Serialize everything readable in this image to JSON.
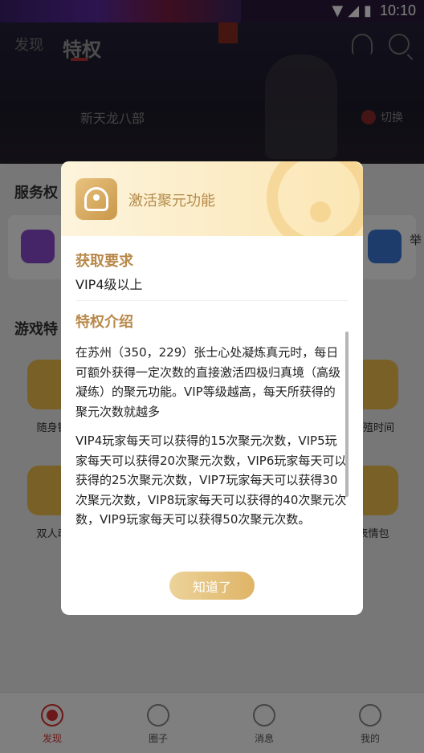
{
  "status_bar": {
    "time": "10:10"
  },
  "header": {
    "tabs": [
      {
        "label": "发现"
      },
      {
        "label": "特权"
      }
    ],
    "game_name": "新天龙八部",
    "switch_label": "切换"
  },
  "background": {
    "section_service": "服务权",
    "section_game": "游戏特",
    "svc_partial_label": "举",
    "grid_items": [
      {
        "label": "随身钳"
      },
      {
        "label": "紧殖时间"
      },
      {
        "label": "双人动"
      },
      {
        "label": "表情包"
      }
    ]
  },
  "bottom_nav": {
    "items": [
      {
        "label": "发现"
      },
      {
        "label": "圈子"
      },
      {
        "label": "消息"
      },
      {
        "label": "我的"
      }
    ]
  },
  "modal": {
    "title": "激活聚元功能",
    "requirement_heading": "获取要求",
    "requirement_value": "VIP4级以上",
    "intro_heading": "特权介绍",
    "intro_paragraphs": [
      "在苏州（350，229）张士心处凝炼真元时，每日可额外获得一定次数的直接激活四极归真境（高级凝练）的聚元功能。VIP等级越高，每天所获得的聚元次数就越多",
      "VIP4玩家每天可以获得的15次聚元次数，VIP5玩家每天可以获得20次聚元次数，VIP6玩家每天可以获得的25次聚元次数，VIP7玩家每天可以获得30次聚元次数，VIP8玩家每天可以获得的40次聚元次数，VIP9玩家每天可以获得50次聚元次数。"
    ],
    "ok_label": "知道了"
  },
  "colors": {
    "accent_gold": "#b8894a",
    "active_red": "#d33333"
  }
}
